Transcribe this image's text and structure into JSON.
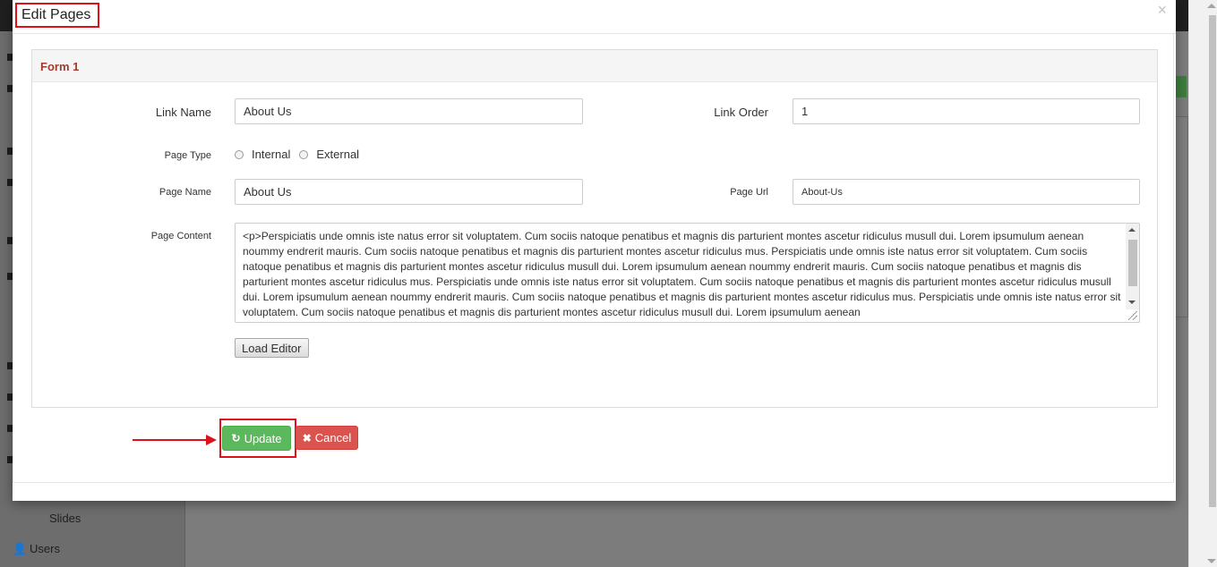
{
  "background": {
    "sidebar_items": [
      {
        "label": "Slides",
        "icon": "none"
      },
      {
        "label": "Users",
        "icon": "user-icon"
      }
    ]
  },
  "modal": {
    "title": "Edit Pages",
    "close_label": "×",
    "panel_title": "Form 1",
    "fields": {
      "link_name": {
        "label": "Link Name",
        "value": "About Us"
      },
      "link_order": {
        "label": "Link Order",
        "value": "1"
      },
      "page_type": {
        "label": "Page Type",
        "options": [
          "Internal",
          "External"
        ],
        "selected": null
      },
      "page_name": {
        "label": "Page Name",
        "value": "About Us"
      },
      "page_url": {
        "label": "Page Url",
        "value": "About-Us"
      },
      "page_content": {
        "label": "Page Content",
        "value": "<p>Perspiciatis unde omnis iste natus error sit voluptatem. Cum sociis natoque penatibus et magnis dis parturient montes ascetur ridiculus musull dui. Lorem ipsumulum aenean noummy endrerit mauris. Cum sociis natoque penatibus et magnis dis parturient montes ascetur ridiculus mus. Perspiciatis unde omnis iste natus error sit voluptatem. Cum sociis natoque penatibus et magnis dis parturient montes ascetur ridiculus musull dui. Lorem ipsumulum aenean noummy endrerit mauris. Cum sociis natoque penatibus et magnis dis parturient montes ascetur ridiculus mus. Perspiciatis unde omnis iste natus error sit voluptatem. Cum sociis natoque penatibus et magnis dis parturient montes ascetur ridiculus musull dui. Lorem ipsumulum aenean noummy endrerit mauris. Cum sociis natoque penatibus et magnis dis parturient montes ascetur ridiculus mus. Perspiciatis unde omnis iste natus error sit voluptatem. Cum sociis natoque penatibus et magnis dis parturient montes ascetur ridiculus musull dui. Lorem ipsumulum aenean"
      }
    },
    "load_editor_label": "Load Editor",
    "update_label": "Update",
    "cancel_label": "Cancel"
  },
  "colors": {
    "annotation_red": "#e0101a",
    "update_green": "#5cb85c",
    "cancel_red": "#d9534f",
    "panel_title": "#a33a2e"
  },
  "icons": {
    "update": "refresh-icon",
    "cancel": "times-icon",
    "close": "close-icon"
  }
}
